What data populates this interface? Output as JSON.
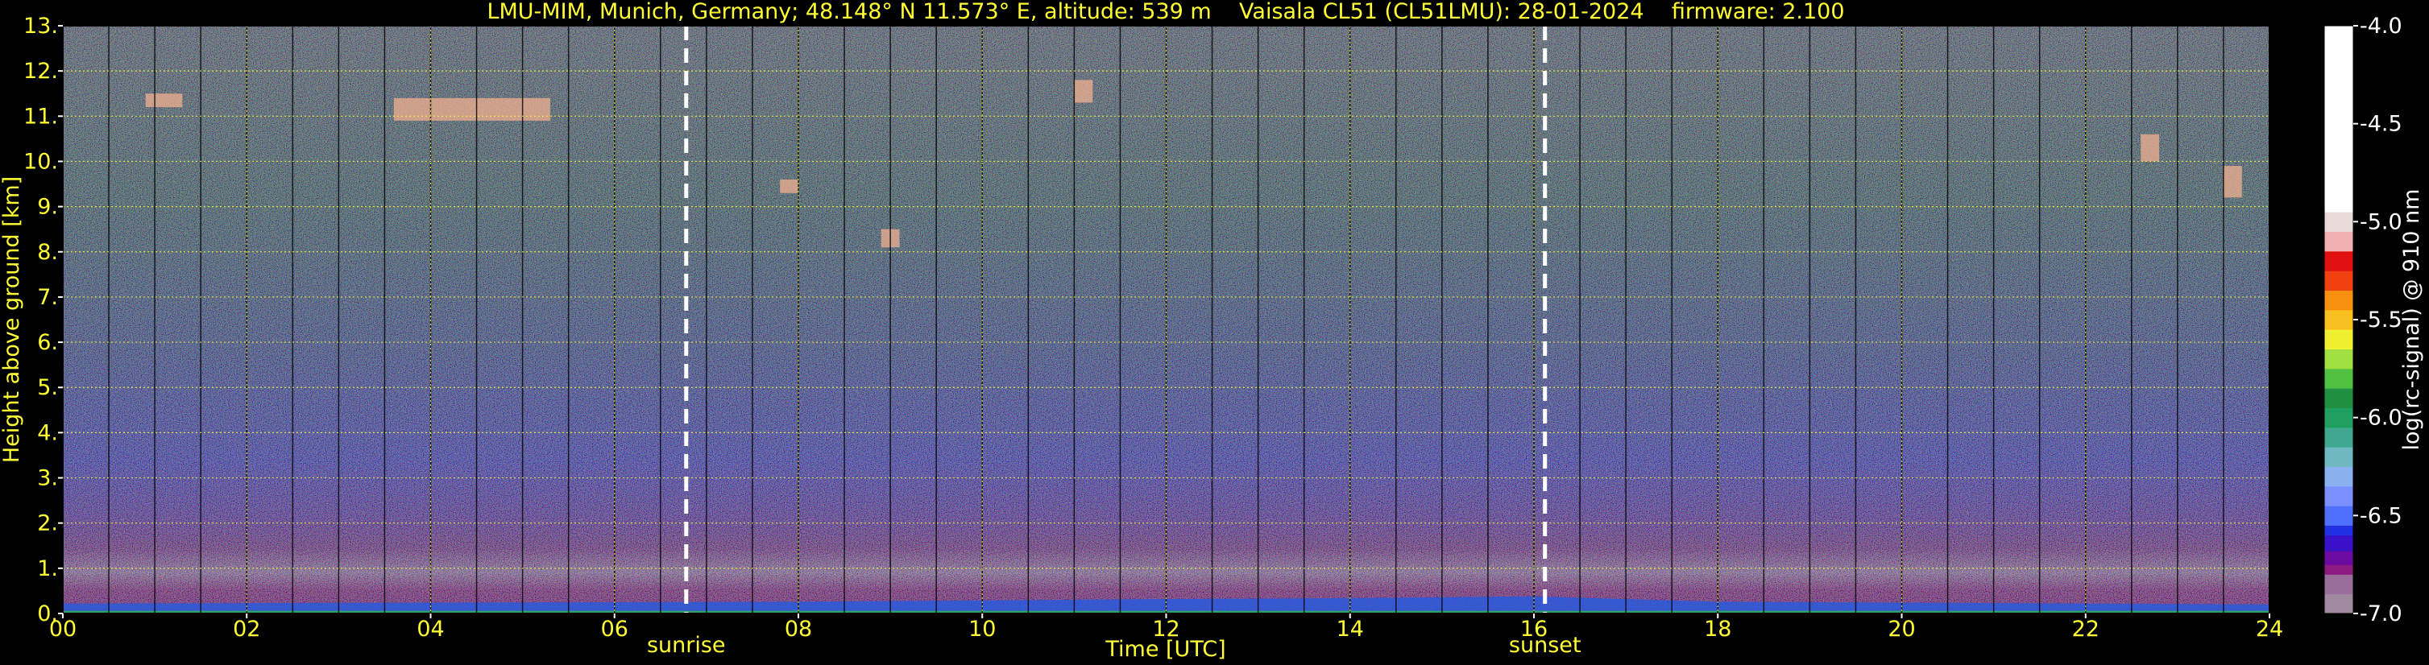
{
  "chart_data": {
    "type": "heatmap",
    "title": "LMU-MIM, Munich, Germany; 48.148° N 11.573° E, altitude: 539 m    Vaisala CL51 (CL51LMU): 28-01-2024    firmware: 2.100",
    "xlabel": "Time [UTC]",
    "ylabel": "Height above ground [km]",
    "colorbar_label": "log(rc-signal) @ 910 nm",
    "xlim": [
      0,
      24
    ],
    "ylim": [
      0,
      13
    ],
    "x_ticks": [
      0,
      2,
      4,
      6,
      8,
      10,
      12,
      14,
      16,
      18,
      20,
      22,
      24
    ],
    "x_tick_labels": [
      "00",
      "02",
      "04",
      "06",
      "08",
      "10",
      "12",
      "14",
      "16",
      "18",
      "20",
      "22",
      "24"
    ],
    "y_ticks": [
      0,
      1,
      2,
      3,
      4,
      5,
      6,
      7,
      8,
      9,
      10,
      11,
      12,
      13
    ],
    "y_tick_labels": [
      "0.",
      "1.",
      "2.",
      "3.",
      "4.",
      "5.",
      "6.",
      "7.",
      "8.",
      "9.",
      "10.",
      "11.",
      "12.",
      "13."
    ],
    "colorbar_range": [
      -7.0,
      -4.0
    ],
    "colorbar_ticks": [
      -7.0,
      -6.5,
      -6.0,
      -5.5,
      -5.0,
      -4.5,
      -4.0
    ],
    "colorbar_tick_labels": [
      "-7.0",
      "-6.5",
      "-6.0",
      "-5.5",
      "-5.0",
      "-4.5",
      "-4.0"
    ],
    "grid": true,
    "events": [
      {
        "name": "sunrise",
        "x": 6.78
      },
      {
        "name": "sunset",
        "x": 16.12
      }
    ],
    "features": {
      "surface_layer_top_km": [
        [
          0,
          0.22
        ],
        [
          4,
          0.24
        ],
        [
          8,
          0.26
        ],
        [
          12,
          0.32
        ],
        [
          14,
          0.34
        ],
        [
          16,
          0.38
        ],
        [
          18,
          0.26
        ],
        [
          20,
          0.24
        ],
        [
          22,
          0.22
        ],
        [
          24,
          0.2
        ]
      ],
      "cloud_patches": [
        {
          "x": [
            0.9,
            1.3
          ],
          "y": [
            11.2,
            11.5
          ]
        },
        {
          "x": [
            3.6,
            5.3
          ],
          "y": [
            10.9,
            11.4
          ]
        },
        {
          "x": [
            7.8,
            8.0
          ],
          "y": [
            9.3,
            9.6
          ]
        },
        {
          "x": [
            8.9,
            9.1
          ],
          "y": [
            8.1,
            8.5
          ]
        },
        {
          "x": [
            11.0,
            11.2
          ],
          "y": [
            11.3,
            11.8
          ]
        },
        {
          "x": [
            22.6,
            22.8
          ],
          "y": [
            10.0,
            10.6
          ]
        },
        {
          "x": [
            23.5,
            23.7
          ],
          "y": [
            9.2,
            9.9
          ]
        }
      ]
    },
    "colors": {
      "text": "#ffff33",
      "background": "#000000",
      "event_line": "#ffffff",
      "grid": "#ffff33"
    }
  }
}
